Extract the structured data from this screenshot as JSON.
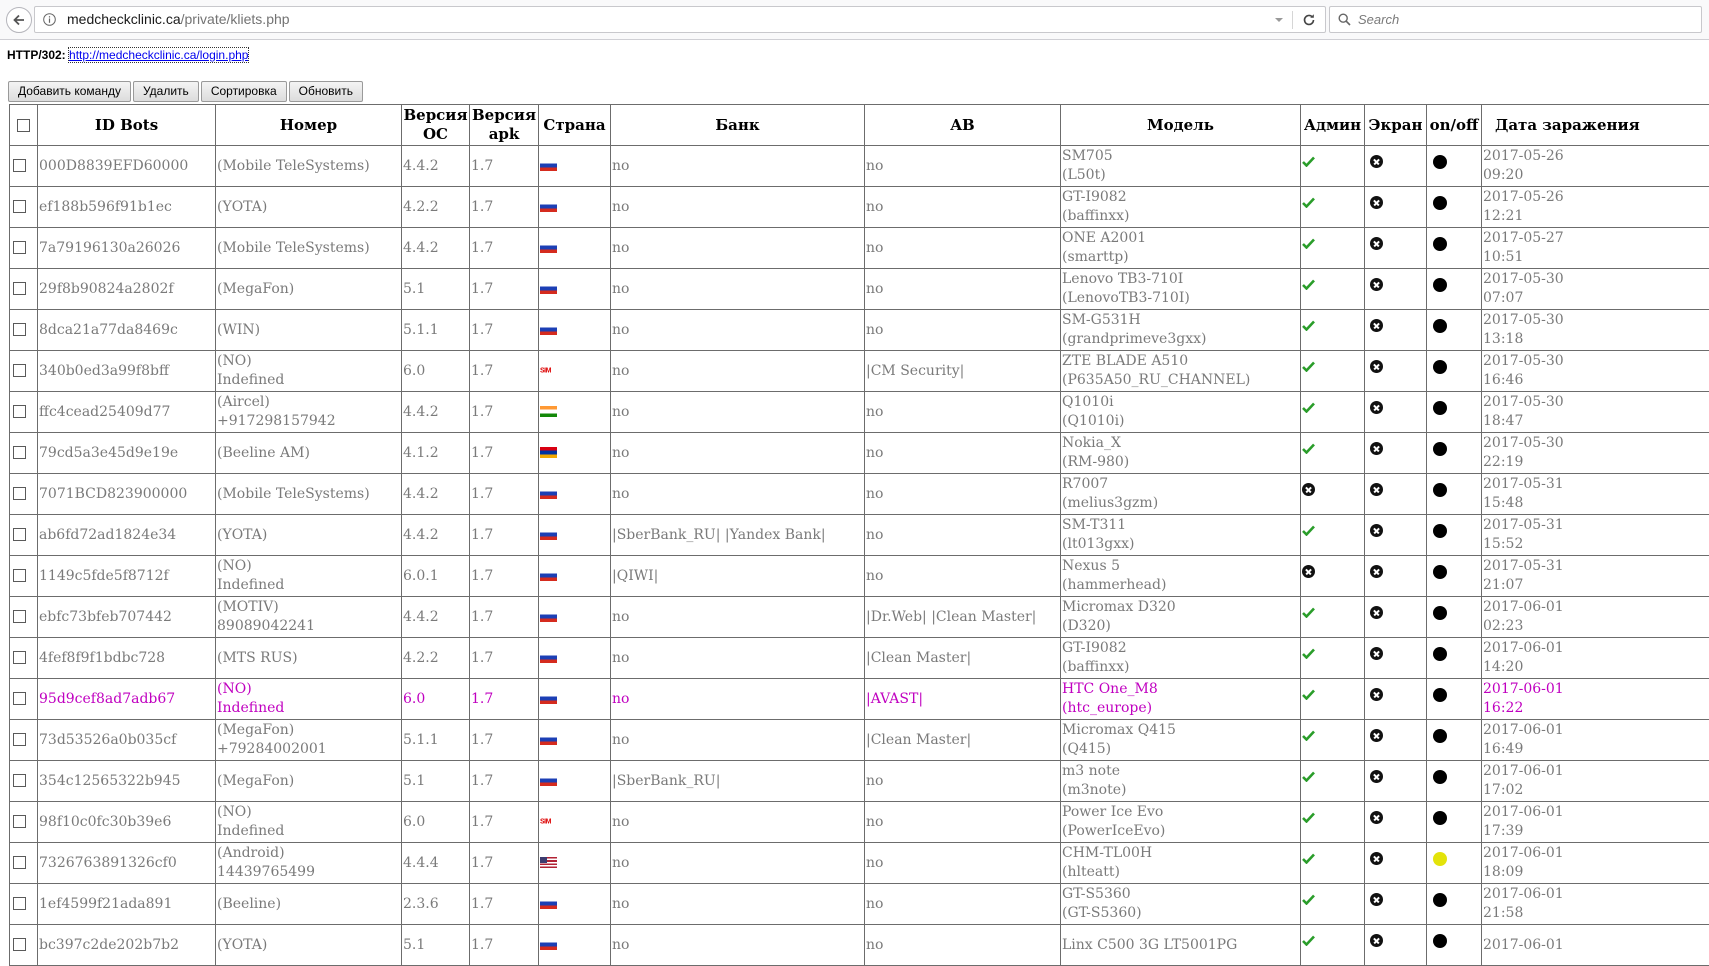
{
  "browser": {
    "url_host": "medcheckclinic.ca",
    "url_path": "/private/kliets.php",
    "search_placeholder": "Search"
  },
  "status": {
    "label": "HTTP/302:",
    "link": "http://medcheckclinic.ca/login.php"
  },
  "toolbar": {
    "add_command": "Добавить команду",
    "delete": "Удалить",
    "sort": "Сортировка",
    "refresh": "Обновить"
  },
  "columns": {
    "id_bots": "ID Bots",
    "number": "Номер",
    "os_version": "Версия ОС",
    "apk_version": "Версия apk",
    "country": "Страна",
    "bank": "Банк",
    "av": "AB",
    "model": "Модель",
    "admin": "Админ",
    "screen": "Экран",
    "onoff": "on/off",
    "infection_date": "Дата заражения"
  },
  "colors": {
    "highlight_row": "#c000c0",
    "admin_ok": "#2a9d2a",
    "online_yellow": "#e3e30a",
    "status_black": "#000000"
  },
  "rows": [
    {
      "id": "000D8839EFD60000",
      "num1": "(Mobile TeleSystems)",
      "num2": "",
      "os": "4.4.2",
      "apk": "1.7",
      "flag": "ru",
      "bank": "no",
      "av": "no",
      "model1": "SM705",
      "model2": "(L50t)",
      "admin": "check",
      "screen": "x",
      "onoff": "black",
      "date1": "2017-05-26",
      "date2": "09:20"
    },
    {
      "id": "ef188b596f91b1ec",
      "num1": "(YOTA)",
      "num2": "",
      "os": "4.2.2",
      "apk": "1.7",
      "flag": "ru",
      "bank": "no",
      "av": "no",
      "model1": "GT-I9082",
      "model2": "(baffinxx)",
      "admin": "check",
      "screen": "x",
      "onoff": "black",
      "date1": "2017-05-26",
      "date2": "12:21"
    },
    {
      "id": "7a79196130a26026",
      "num1": "(Mobile TeleSystems)",
      "num2": "",
      "os": "4.4.2",
      "apk": "1.7",
      "flag": "ru",
      "bank": "no",
      "av": "no",
      "model1": "ONE A2001",
      "model2": "(smarttp)",
      "admin": "check",
      "screen": "x",
      "onoff": "black",
      "date1": "2017-05-27",
      "date2": "10:51"
    },
    {
      "id": "29f8b90824a2802f",
      "num1": "(MegaFon)",
      "num2": "",
      "os": "5.1",
      "apk": "1.7",
      "flag": "ru",
      "bank": "no",
      "av": "no",
      "model1": "Lenovo TB3-710I",
      "model2": "(LenovoTB3-710I)",
      "admin": "check",
      "screen": "x",
      "onoff": "black",
      "date1": "2017-05-30",
      "date2": "07:07"
    },
    {
      "id": "8dca21a77da8469c",
      "num1": "(WIN)",
      "num2": "",
      "os": "5.1.1",
      "apk": "1.7",
      "flag": "ru",
      "bank": "no",
      "av": "no",
      "model1": "SM-G531H",
      "model2": "(grandprimeve3gxx)",
      "admin": "check",
      "screen": "x",
      "onoff": "black",
      "date1": "2017-05-30",
      "date2": "13:18"
    },
    {
      "id": "340b0ed3a99f8bff",
      "num1": "(NO)",
      "num2": "Indefined",
      "os": "6.0",
      "apk": "1.7",
      "flag": "sim",
      "bank": "no",
      "av": "|CM Security|",
      "model1": "ZTE BLADE A510",
      "model2": "(P635A50_RU_CHANNEL)",
      "admin": "check",
      "screen": "x",
      "onoff": "black",
      "date1": "2017-05-30",
      "date2": "16:46"
    },
    {
      "id": "ffc4cead25409d77",
      "num1": "(Aircel)",
      "num2": "+917298157942",
      "os": "4.4.2",
      "apk": "1.7",
      "flag": "in",
      "bank": "no",
      "av": "no",
      "model1": "Q1010i",
      "model2": "(Q1010i)",
      "admin": "check",
      "screen": "x",
      "onoff": "black",
      "date1": "2017-05-30",
      "date2": "18:47"
    },
    {
      "id": "79cd5a3e45d9e19e",
      "num1": "(Beeline AM)",
      "num2": "",
      "os": "4.1.2",
      "apk": "1.7",
      "flag": "am",
      "bank": "no",
      "av": "no",
      "model1": "Nokia_X",
      "model2": "(RM-980)",
      "admin": "check",
      "screen": "x",
      "onoff": "black",
      "date1": "2017-05-30",
      "date2": "22:19"
    },
    {
      "id": "7071BCD823900000",
      "num1": "(Mobile TeleSystems)",
      "num2": "",
      "os": "4.4.2",
      "apk": "1.7",
      "flag": "ru",
      "bank": "no",
      "av": "no",
      "model1": "R7007",
      "model2": "(melius3gzm)",
      "admin": "x",
      "screen": "x",
      "onoff": "black",
      "date1": "2017-05-31",
      "date2": "15:48"
    },
    {
      "id": "ab6fd72ad1824e34",
      "num1": "(YOTA)",
      "num2": "",
      "os": "4.4.2",
      "apk": "1.7",
      "flag": "ru",
      "bank": "|SberBank_RU| |Yandex Bank|",
      "av": "no",
      "model1": "SM-T311",
      "model2": "(lt013gxx)",
      "admin": "check",
      "screen": "x",
      "onoff": "black",
      "date1": "2017-05-31",
      "date2": "15:52"
    },
    {
      "id": "1149c5fde5f8712f",
      "num1": "(NO)",
      "num2": "Indefined",
      "os": "6.0.1",
      "apk": "1.7",
      "flag": "ru",
      "bank": "|QIWI|",
      "av": "no",
      "model1": "Nexus 5",
      "model2": "(hammerhead)",
      "admin": "x",
      "screen": "x",
      "onoff": "black",
      "date1": "2017-05-31",
      "date2": "21:07"
    },
    {
      "id": "ebfc73bfeb707442",
      "num1": "(MOTIV)",
      "num2": "89089042241",
      "os": "4.4.2",
      "apk": "1.7",
      "flag": "ru",
      "bank": "no",
      "av": "|Dr.Web| |Clean Master|",
      "model1": "Micromax D320",
      "model2": "(D320)",
      "admin": "check",
      "screen": "x",
      "onoff": "black",
      "date1": "2017-06-01",
      "date2": "02:23"
    },
    {
      "id": "4fef8f9f1bdbc728",
      "num1": "(MTS RUS)",
      "num2": "",
      "os": "4.2.2",
      "apk": "1.7",
      "flag": "ru",
      "bank": "no",
      "av": "|Clean Master|",
      "model1": "GT-I9082",
      "model2": "(baffinxx)",
      "admin": "check",
      "screen": "x",
      "onoff": "black",
      "date1": "2017-06-01",
      "date2": "14:20"
    },
    {
      "id": "95d9cef8ad7adb67",
      "num1": "(NO)",
      "num2": "Indefined",
      "os": "6.0",
      "apk": "1.7",
      "flag": "ru",
      "bank": "no",
      "av": "|AVAST|",
      "model1": "HTC One_M8",
      "model2": "(htc_europe)",
      "admin": "check",
      "screen": "x",
      "onoff": "black",
      "date1": "2017-06-01",
      "date2": "16:22",
      "highlight": true
    },
    {
      "id": "73d53526a0b035cf",
      "num1": "(MegaFon)",
      "num2": "+79284002001",
      "os": "5.1.1",
      "apk": "1.7",
      "flag": "ru",
      "bank": "no",
      "av": "|Clean Master|",
      "model1": "Micromax Q415",
      "model2": "(Q415)",
      "admin": "check",
      "screen": "x",
      "onoff": "black",
      "date1": "2017-06-01",
      "date2": "16:49"
    },
    {
      "id": "354c12565322b945",
      "num1": "(MegaFon)",
      "num2": "",
      "os": "5.1",
      "apk": "1.7",
      "flag": "ru",
      "bank": "|SberBank_RU|",
      "av": "no",
      "model1": "m3 note",
      "model2": "(m3note)",
      "admin": "check",
      "screen": "x",
      "onoff": "black",
      "date1": "2017-06-01",
      "date2": "17:02"
    },
    {
      "id": "98f10c0fc30b39e6",
      "num1": "(NO)",
      "num2": "Indefined",
      "os": "6.0",
      "apk": "1.7",
      "flag": "sim",
      "bank": "no",
      "av": "no",
      "model1": "Power Ice Evo",
      "model2": "(PowerIceEvo)",
      "admin": "check",
      "screen": "x",
      "onoff": "black",
      "date1": "2017-06-01",
      "date2": "17:39"
    },
    {
      "id": "7326763891326cf0",
      "num1": "(Android)",
      "num2": "14439765499",
      "os": "4.4.4",
      "apk": "1.7",
      "flag": "us",
      "bank": "no",
      "av": "no",
      "model1": "CHM-TL00H",
      "model2": "(hlteatt)",
      "admin": "check",
      "screen": "x",
      "onoff": "yellow",
      "date1": "2017-06-01",
      "date2": "18:09"
    },
    {
      "id": "1ef4599f21ada891",
      "num1": "(Beeline)",
      "num2": "",
      "os": "2.3.6",
      "apk": "1.7",
      "flag": "ru",
      "bank": "no",
      "av": "no",
      "model1": "GT-S5360",
      "model2": "(GT-S5360)",
      "admin": "check",
      "screen": "x",
      "onoff": "black",
      "date1": "2017-06-01",
      "date2": "21:58"
    },
    {
      "id": "bc397c2de202b7b2",
      "num1": "(YOTA)",
      "num2": "",
      "os": "5.1",
      "apk": "1.7",
      "flag": "ru",
      "bank": "no",
      "av": "no",
      "model1": "Linx C500 3G LT5001PG",
      "model2": "",
      "admin": "check",
      "screen": "x",
      "onoff": "black",
      "date1": "2017-06-01",
      "date2": ""
    }
  ]
}
